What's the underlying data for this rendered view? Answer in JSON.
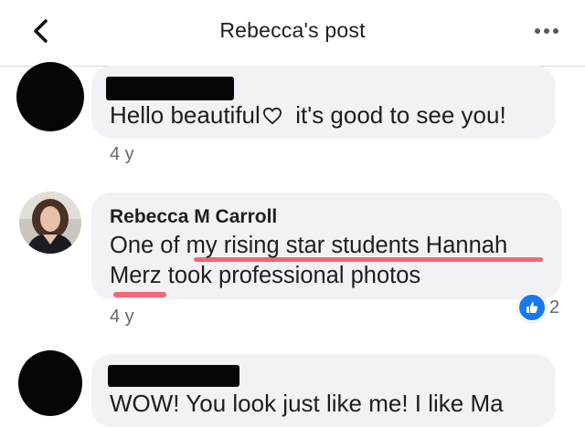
{
  "header": {
    "title": "Rebecca's post"
  },
  "comments": [
    {
      "author": "",
      "text": "Hello beautiful",
      "text_after_heart": "  it's good to see you!",
      "time": "4 y"
    },
    {
      "author": "Rebecca M Carroll",
      "line1": "One of my rising star students Hannah",
      "line2": "Merz took professional photos",
      "time": "4 y",
      "reaction_count": "2",
      "reaction_icon": "like-icon",
      "reaction_color": "#1877f2"
    },
    {
      "author": "",
      "text": "WOW! You look just like me! I like  Ma"
    }
  ],
  "colors": {
    "bubble": "#f0f2f5",
    "underline": "#f25a6b",
    "meta": "#65676b"
  }
}
